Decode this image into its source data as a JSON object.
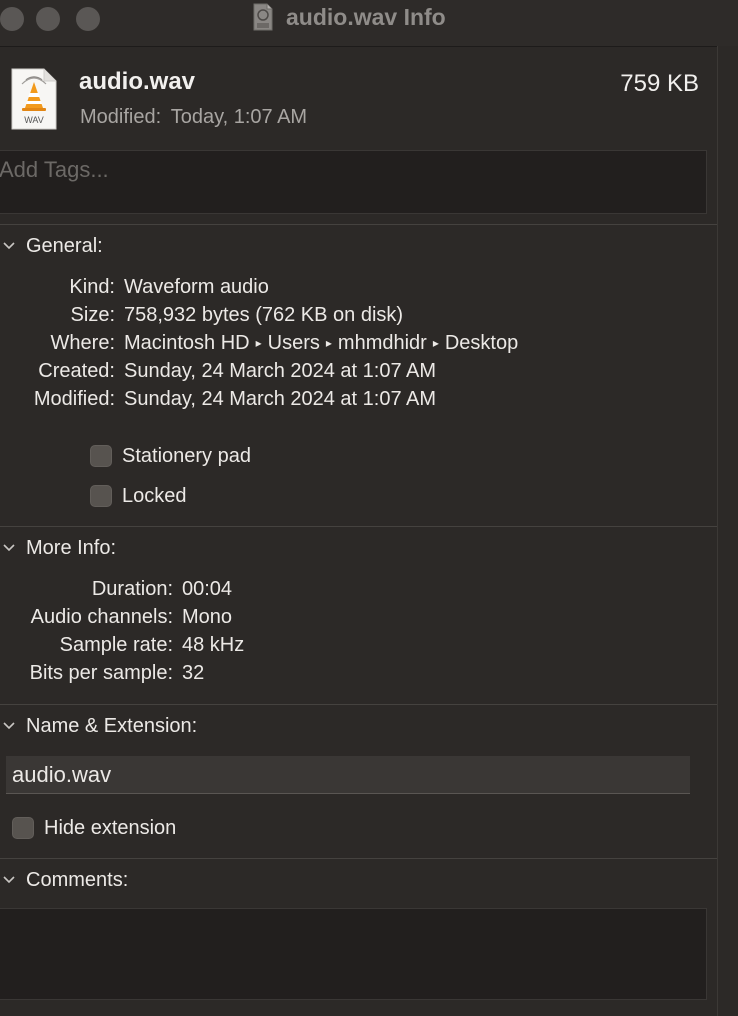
{
  "window": {
    "title": "audio.wav Info"
  },
  "header": {
    "file_name": "audio.wav",
    "file_size": "759 KB",
    "modified_label": "Modified:",
    "modified_value": "Today, 1:07 AM",
    "icon_badge": "WAV"
  },
  "tags": {
    "placeholder": "Add Tags..."
  },
  "general": {
    "title": "General:",
    "rows": [
      {
        "label": "Kind:",
        "value": "Waveform audio"
      },
      {
        "label": "Size:",
        "value": "758,932 bytes (762 KB on disk)"
      },
      {
        "label": "Where:",
        "path": [
          "Macintosh HD",
          "Users",
          "mhmdhidr",
          "Desktop"
        ]
      },
      {
        "label": "Created:",
        "value": "Sunday, 24 March 2024 at 1:07 AM"
      },
      {
        "label": "Modified:",
        "value": "Sunday, 24 March 2024 at 1:07 AM"
      }
    ],
    "stationery_label": "Stationery pad",
    "locked_label": "Locked"
  },
  "more_info": {
    "title": "More Info:",
    "rows": [
      {
        "label": "Duration:",
        "value": "00:04"
      },
      {
        "label": "Audio channels:",
        "value": "Mono"
      },
      {
        "label": "Sample rate:",
        "value": "48 kHz"
      },
      {
        "label": "Bits per sample:",
        "value": "32"
      }
    ]
  },
  "name_extension": {
    "title": "Name & Extension:",
    "value": "audio.wav",
    "hide_extension_label": "Hide extension"
  },
  "comments": {
    "title": "Comments:"
  },
  "icons": {
    "title_icon": "wav-file-icon",
    "file_icon": "vlc-wav-file-icon",
    "chevron": "chevron-down-icon"
  }
}
